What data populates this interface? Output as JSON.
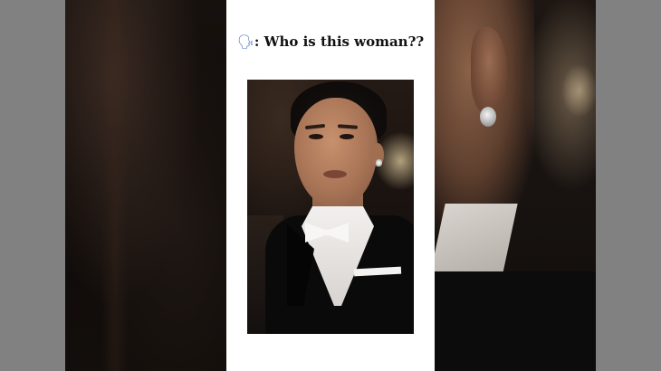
{
  "caption": {
    "emoji": "🗣",
    "text": ": Who is this woman??"
  },
  "colors": {
    "letterbox": "#818181",
    "card": "#ffffff",
    "caption_text": "#111111"
  },
  "photo": {
    "subject": "portrait-photo"
  }
}
